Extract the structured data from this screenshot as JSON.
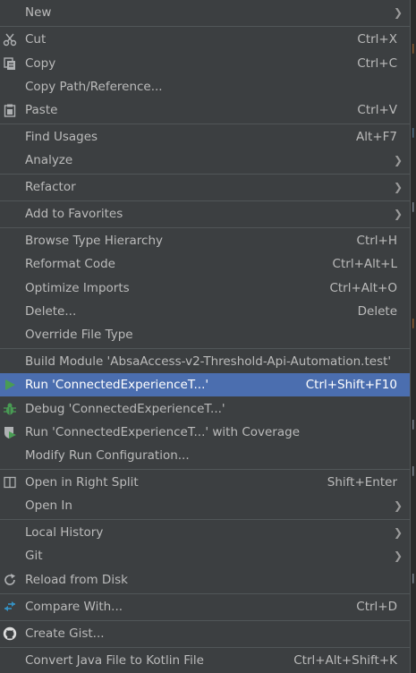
{
  "menu": {
    "new": {
      "label": "New"
    },
    "cut": {
      "label": "Cut",
      "shortcut": "Ctrl+X",
      "icon": "scissors-icon"
    },
    "copy": {
      "label": "Copy",
      "shortcut": "Ctrl+C",
      "icon": "copy-icon"
    },
    "copy_path": {
      "label": "Copy Path/Reference..."
    },
    "paste": {
      "label": "Paste",
      "shortcut": "Ctrl+V",
      "icon": "clipboard-icon"
    },
    "find_usages": {
      "label": "Find Usages",
      "shortcut": "Alt+F7"
    },
    "analyze": {
      "label": "Analyze"
    },
    "refactor": {
      "label": "Refactor"
    },
    "add_favorites": {
      "label": "Add to Favorites"
    },
    "browse_hierarchy": {
      "label": "Browse Type Hierarchy",
      "shortcut": "Ctrl+H"
    },
    "reformat": {
      "label": "Reformat Code",
      "shortcut": "Ctrl+Alt+L"
    },
    "optimize_imports": {
      "label": "Optimize Imports",
      "shortcut": "Ctrl+Alt+O"
    },
    "delete": {
      "label": "Delete...",
      "shortcut": "Delete"
    },
    "override_type": {
      "label": "Override File Type"
    },
    "build_module": {
      "label": "Build Module 'AbsaAccess-v2-Threshold-Api-Automation.test'"
    },
    "run": {
      "label": "Run 'ConnectedExperienceT...'",
      "shortcut": "Ctrl+Shift+F10",
      "icon": "run-icon"
    },
    "debug": {
      "label": "Debug 'ConnectedExperienceT...'",
      "icon": "debug-icon"
    },
    "run_coverage": {
      "label": "Run 'ConnectedExperienceT...' with Coverage",
      "icon": "coverage-icon"
    },
    "modify_run": {
      "label": "Modify Run Configuration..."
    },
    "open_right_split": {
      "label": "Open in Right Split",
      "shortcut": "Shift+Enter",
      "icon": "split-icon"
    },
    "open_in": {
      "label": "Open In"
    },
    "local_history": {
      "label": "Local History"
    },
    "git": {
      "label": "Git"
    },
    "reload": {
      "label": "Reload from Disk",
      "icon": "reload-icon"
    },
    "compare_with": {
      "label": "Compare With...",
      "shortcut": "Ctrl+D",
      "icon": "compare-icon"
    },
    "create_gist": {
      "label": "Create Gist...",
      "icon": "github-icon"
    },
    "convert_kotlin": {
      "label": "Convert Java File to Kotlin File",
      "shortcut": "Ctrl+Alt+Shift+K"
    }
  },
  "colors": {
    "menu_bg": "#3c3f41",
    "text": "#bbbbbb",
    "selected_bg": "#4b6eaf",
    "separator": "#515658",
    "run_green": "#499c54"
  }
}
